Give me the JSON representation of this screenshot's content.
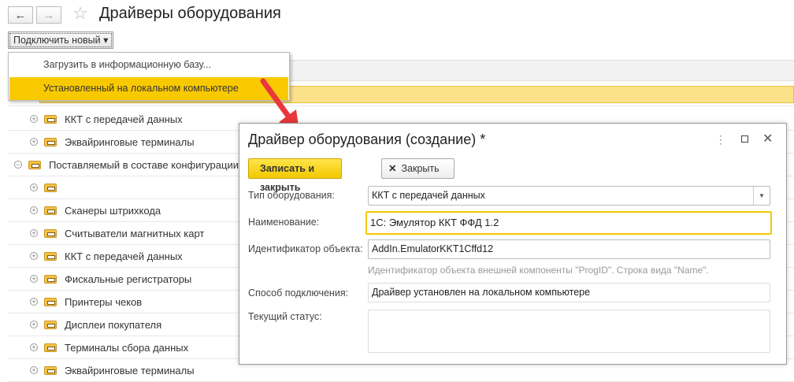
{
  "header": {
    "title": "Драйверы оборудования",
    "back": "←",
    "forward": "→",
    "connect_label": "Подключить новый ▾"
  },
  "menu": {
    "items": [
      "Загрузить в информационную базу...",
      "Установленный на локальном компьютере"
    ]
  },
  "tree": [
    {
      "label": "ККТ с передачей данных",
      "level": 1,
      "sign": "⊕"
    },
    {
      "label": "Эквайринговые терминалы",
      "level": 1,
      "sign": "⊕"
    },
    {
      "label": "Поставляемый в составе конфигурации",
      "level": 0,
      "sign": "⊖"
    },
    {
      "label": "",
      "level": 1,
      "sign": "⊕"
    },
    {
      "label": "Сканеры штрихкода",
      "level": 1,
      "sign": "⊕"
    },
    {
      "label": "Считыватели магнитных карт",
      "level": 1,
      "sign": "⊕"
    },
    {
      "label": "ККТ с передачей данных",
      "level": 1,
      "sign": "⊕"
    },
    {
      "label": "Фискальные регистраторы",
      "level": 1,
      "sign": "⊕"
    },
    {
      "label": "Принтеры чеков",
      "level": 1,
      "sign": "⊕"
    },
    {
      "label": "Дисплеи покупателя",
      "level": 1,
      "sign": "⊕"
    },
    {
      "label": "Терминалы сбора данных",
      "level": 1,
      "sign": "⊕"
    },
    {
      "label": "Эквайринговые терминалы",
      "level": 1,
      "sign": "⊕"
    }
  ],
  "dialog": {
    "title": "Драйвер оборудования (создание) *",
    "save_close": "Записать и закрыть",
    "close": "Закрыть",
    "type_label": "Тип оборудования:",
    "type_value": "ККТ с передачей данных",
    "name_label": "Наименование:",
    "name_value": "1С: Эмулятор ККТ ФФД 1.2",
    "id_label": "Идентификатор объекта:",
    "id_value": "AddIn.EmulatorKKT1Cffd12",
    "id_hint": "Идентификатор объекта внешней компоненты \"ProgID\". Строка вида \"Name\".",
    "conn_label": "Способ подключения:",
    "conn_value": "Драйвер установлен на локальном компьютере",
    "status_label": "Текущий статус:",
    "status_value": ""
  },
  "colors": {
    "accent": "#f9d000",
    "arrow": "#e8383d"
  }
}
